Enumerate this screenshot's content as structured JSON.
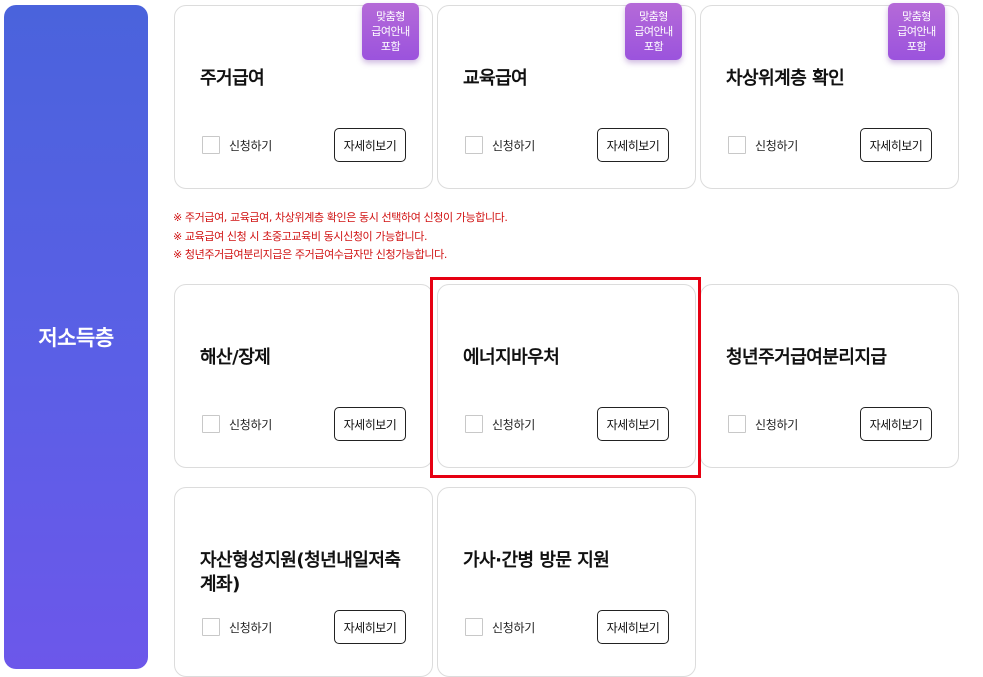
{
  "category": {
    "label": "저소득층"
  },
  "common": {
    "apply_label": "신청하기",
    "detail_label": "자세히보기"
  },
  "badge": {
    "line1": "맞춤형",
    "line2": "급여안내",
    "line3": "포함"
  },
  "cards": [
    {
      "title": "주거급여",
      "badge": true
    },
    {
      "title": "교육급여",
      "badge": true
    },
    {
      "title": "차상위계층 확인",
      "badge": true
    },
    {
      "title": "해산/장제",
      "badge": false
    },
    {
      "title": "에너지바우처",
      "badge": false,
      "highlighted": true
    },
    {
      "title": "청년주거급여분리지급",
      "badge": false
    },
    {
      "title": "자산형성지원(청년내일저축계좌)",
      "badge": false
    },
    {
      "title": "가사·간병 방문 지원",
      "badge": false
    }
  ],
  "notices": [
    "※ 주거급여, 교육급여, 차상위계층 확인은 동시 선택하여 신청이 가능합니다.",
    "※ 교육급여 신청 시 초중고교육비 동시신청이 가능합니다.",
    "※ 청년주거급여분리지급은 주거급여수급자만 신청가능합니다."
  ],
  "colors": {
    "category_gradient_top": "#4a63dc",
    "category_gradient_bottom": "#6c57ea",
    "badge": "#a85fdb",
    "notice_text": "#d01212",
    "highlight_border": "#e60012"
  }
}
